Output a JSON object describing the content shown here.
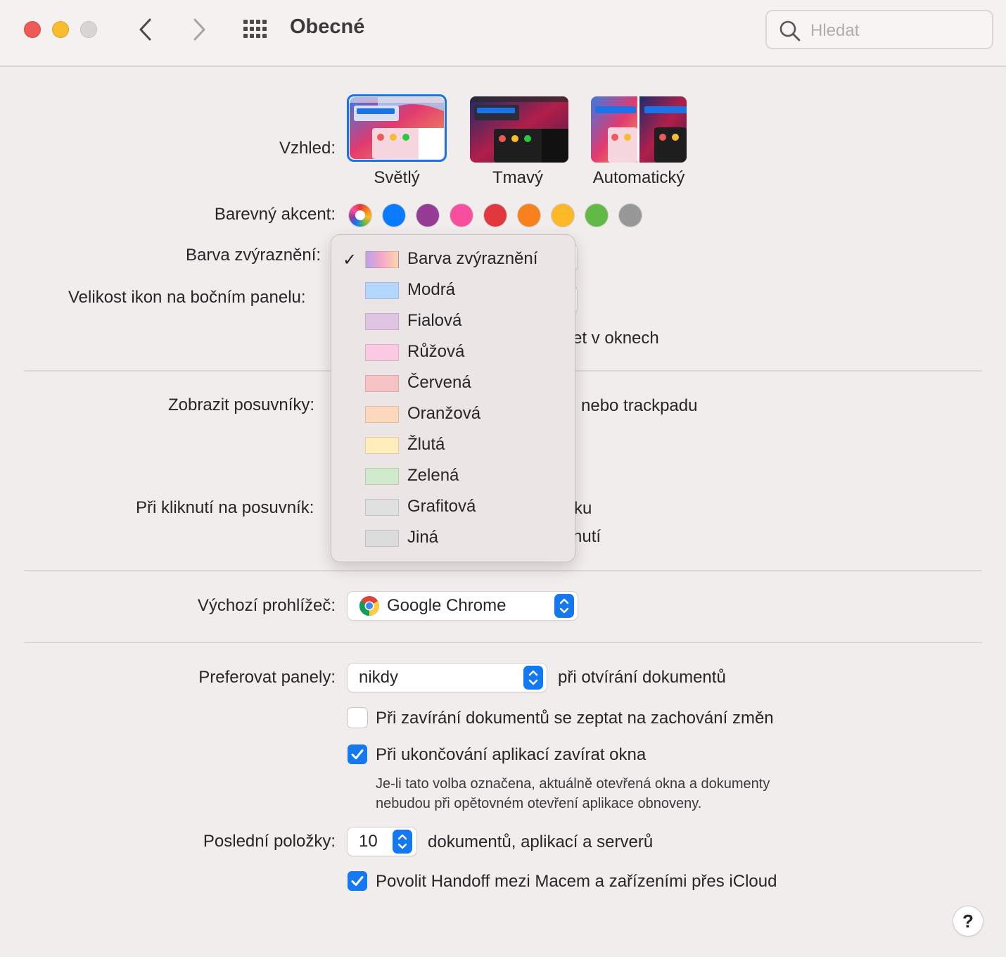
{
  "window": {
    "title": "Obecné",
    "search_placeholder": "Hledat"
  },
  "appearance": {
    "label": "Vzhled:",
    "options": [
      "Světlý",
      "Tmavý",
      "Automatický"
    ],
    "selected": "Světlý"
  },
  "accent": {
    "label": "Barevný akcent:",
    "colors": [
      "multicolor",
      "#0a7aff",
      "#953d96",
      "#f74f9e",
      "#e0383e",
      "#f7821b",
      "#fcb827",
      "#62ba46",
      "#989898"
    ]
  },
  "highlight": {
    "label": "Barva zvýraznění:"
  },
  "sidebar_icons": {
    "label": "Velikost ikon na bočním panelu:"
  },
  "partial": {
    "wallpaper_tint": "et v oknech",
    "scrollbars_tail": "i nebo trackpadu",
    "click_tail_1": "ku",
    "click_tail_2": "nutí"
  },
  "scrollbars": {
    "label": "Zobrazit posuvníky:"
  },
  "scroll_click": {
    "label": "Při kliknutí na posuvník:"
  },
  "highlight_menu": {
    "items": [
      {
        "label": "Barva zvýraznění",
        "color": "multicolor",
        "checked": true
      },
      {
        "label": "Modrá",
        "color": "#b3d7ff",
        "checked": false
      },
      {
        "label": "Fialová",
        "color": "#dfc5e2",
        "checked": false
      },
      {
        "label": "Růžová",
        "color": "#fcc9e3",
        "checked": false
      },
      {
        "label": "Červená",
        "color": "#f6c2c3",
        "checked": false
      },
      {
        "label": "Oranžová",
        "color": "#fcd8bc",
        "checked": false
      },
      {
        "label": "Žlutá",
        "color": "#ffeebb",
        "checked": false
      },
      {
        "label": "Zelená",
        "color": "#d0eacb",
        "checked": false
      },
      {
        "label": "Grafitová",
        "color": "#e0e0e0",
        "checked": false
      },
      {
        "label": "Jiná",
        "color": "#dcdcdc",
        "checked": false
      }
    ]
  },
  "browser": {
    "label": "Výchozí prohlížeč:",
    "value": "Google Chrome"
  },
  "tabs": {
    "label": "Preferovat panely:",
    "value": "nikdy",
    "suffix": "při otvírání dokumentů"
  },
  "checkboxes": {
    "ask_keep_changes": {
      "label": "Při zavírání dokumentů se zeptat na zachování změn",
      "checked": false
    },
    "close_windows": {
      "label": "Při ukončování aplikací zavírat okna",
      "checked": true
    },
    "close_windows_desc_1": "Je-li tato volba označena, aktuálně otevřená okna a dokumenty",
    "close_windows_desc_2": "nebudou při opětovném otevření aplikace obnoveny.",
    "handoff": {
      "label": "Povolit Handoff mezi Macem a zařízeními přes iCloud",
      "checked": true
    }
  },
  "recent": {
    "label": "Poslední položky:",
    "value": "10",
    "suffix": "dokumentů, aplikací a serverů"
  },
  "help": "?"
}
